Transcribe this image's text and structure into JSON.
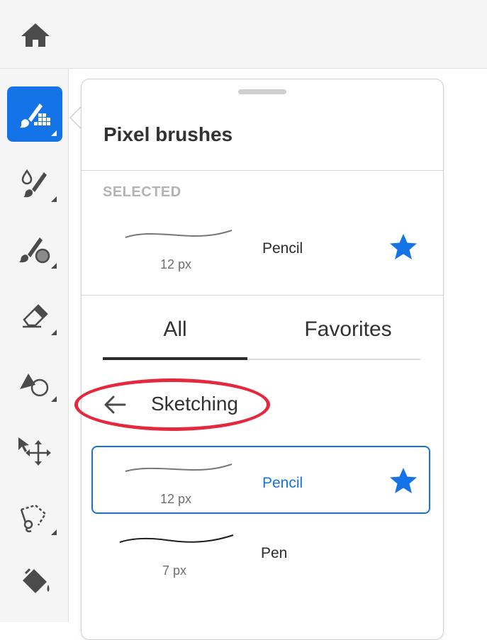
{
  "topbar": {
    "home_icon": "home-icon"
  },
  "toolbar": {
    "tools": [
      {
        "name": "pixel-brush-tool",
        "icon": "pixel-brush-icon",
        "active": true
      },
      {
        "name": "mixer-brush-tool",
        "icon": "mixer-brush-icon",
        "active": false
      },
      {
        "name": "healing-brush-tool",
        "icon": "healing-brush-icon",
        "active": false
      },
      {
        "name": "eraser-tool",
        "icon": "eraser-icon",
        "active": false
      },
      {
        "name": "shape-tool",
        "icon": "shape-icon",
        "active": false
      },
      {
        "name": "move-tool",
        "icon": "move-icon",
        "active": false
      },
      {
        "name": "lasso-tool",
        "icon": "lasso-icon",
        "active": false
      },
      {
        "name": "paint-bucket-tool",
        "icon": "paint-bucket-icon",
        "active": false
      }
    ],
    "accent_color": "#1473e6"
  },
  "panel": {
    "title": "Pixel brushes",
    "selected_section_label": "SELECTED",
    "selected_brush": {
      "name": "Pencil",
      "size": "12 px",
      "favorite": true
    },
    "tabs": [
      {
        "label": "All",
        "active": true
      },
      {
        "label": "Favorites",
        "active": false
      }
    ],
    "category": {
      "label": "Sketching"
    },
    "brushes": [
      {
        "name": "Pencil",
        "size": "12 px",
        "favorite": true,
        "selected": true
      },
      {
        "name": "Pen",
        "size": "7 px",
        "favorite": false,
        "selected": false
      }
    ],
    "highlight_color": "#e6283e",
    "star_color": "#1473e6"
  }
}
